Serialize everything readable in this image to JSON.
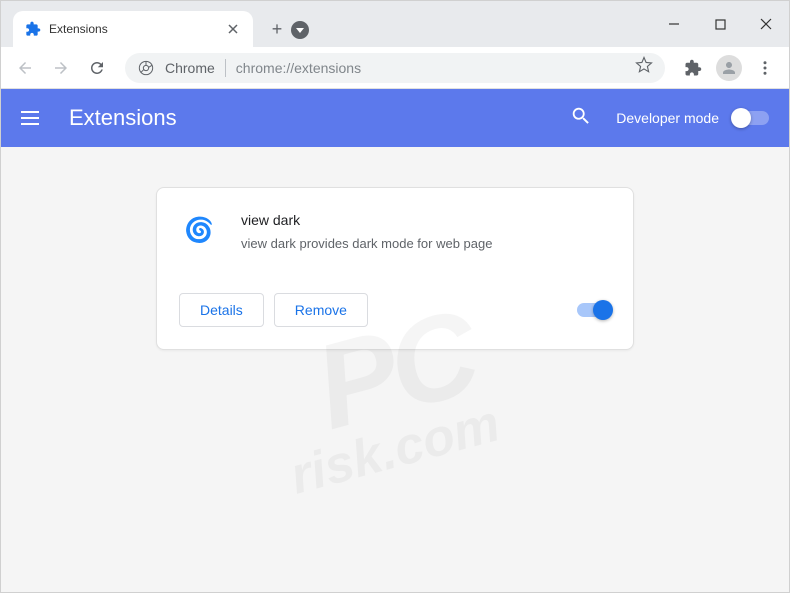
{
  "tab": {
    "title": "Extensions"
  },
  "omnibox": {
    "scheme_label": "Chrome",
    "url": "chrome://extensions"
  },
  "header": {
    "title": "Extensions",
    "dev_mode_label": "Developer mode"
  },
  "extension": {
    "icon_emoji": "🌀",
    "name": "view dark",
    "description": "view dark provides dark mode for web page",
    "details_label": "Details",
    "remove_label": "Remove",
    "enabled": true
  },
  "watermark": {
    "main": "PC",
    "sub": "risk.com"
  }
}
